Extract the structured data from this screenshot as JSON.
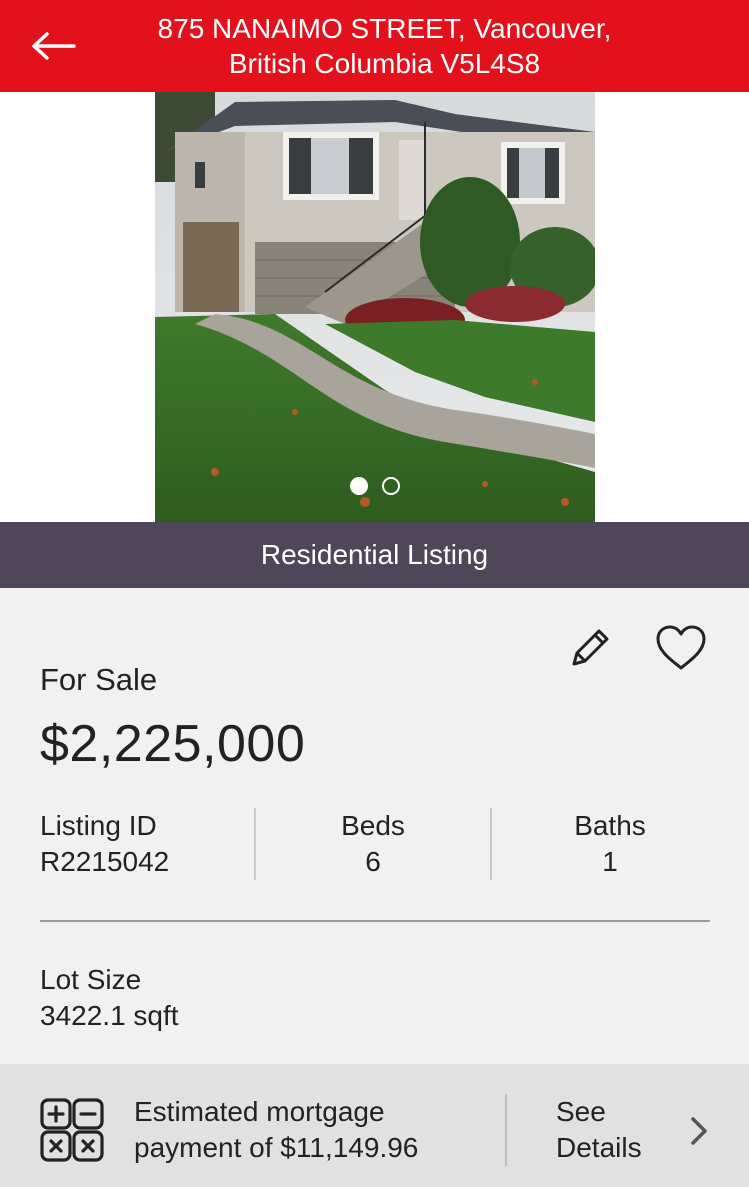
{
  "header": {
    "title_line1": "875 NANAIMO STREET, Vancouver,",
    "title_line2": "British Columbia V5L4S8",
    "back_icon": "arrow-left-icon"
  },
  "colors": {
    "header_bg": "#e3111b",
    "listing_bar_bg": "#4f4759",
    "page_bg": "#f1f1f1",
    "mortgage_bg": "#e1e1e1"
  },
  "gallery": {
    "photo_count": 2,
    "active_index": 0
  },
  "listing_type": "Residential Listing",
  "actions": {
    "edit_icon": "pencil-icon",
    "favorite_icon": "heart-icon"
  },
  "listing": {
    "status": "For Sale",
    "price": "$2,225,000",
    "id_label": "Listing ID",
    "id_value": "R2215042",
    "beds_label": "Beds",
    "beds_value": "6",
    "baths_label": "Baths",
    "baths_value": "1",
    "lot_label": "Lot Size",
    "lot_value": "3422.1 sqft"
  },
  "mortgage": {
    "icon": "calculator-icon",
    "line1": "Estimated mortgage",
    "line2": "payment of $11,149.96",
    "link_line1": "See",
    "link_line2": "Details",
    "link_icon": "chevron-right-icon"
  }
}
